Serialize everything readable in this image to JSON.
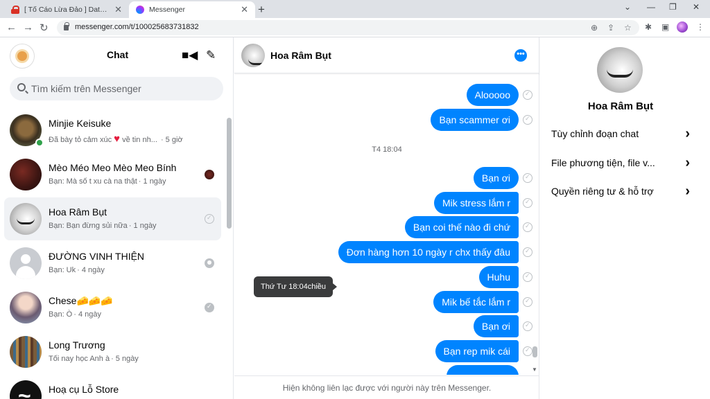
{
  "browser": {
    "tabs": [
      {
        "title": "[ Tố Cáo Lừa Đảo ] Data hệ thống",
        "close": "✕"
      },
      {
        "title": "Messenger",
        "close": "✕"
      }
    ],
    "new_tab": "+",
    "url": "messenger.com/t/100025683731832",
    "window_controls": {
      "dropdown": "⌄",
      "minimize": "—",
      "restore": "❐",
      "close": "✕"
    },
    "nav": {
      "back": "←",
      "forward": "→",
      "reload": "↻"
    },
    "omni_icons": {
      "zoom": "⊕",
      "share": "⇪",
      "bookmark": "☆"
    },
    "ext_icons": {
      "extensions": "✱",
      "sidepanel": "▣",
      "menu": "⋮"
    }
  },
  "sidebar": {
    "title": "Chat",
    "video_icon": "■◀",
    "compose_icon": "✎",
    "search_placeholder": "Tìm kiếm trên Messenger",
    "conversations": [
      {
        "name": "Minjie Keisuke",
        "preview": "Đã bày tỏ cảm xúc",
        "preview_tail": "về tin nh...",
        "time": "· 5 giờ"
      },
      {
        "name": "Mèo Méo Meo Mèo Meo Bính",
        "preview": "Bạn: Mà số t xu cà na thật",
        "time": "· 1 ngày"
      },
      {
        "name": "Hoa Râm Bụt",
        "preview": "Bạn: Bạn đừng sủi nữa",
        "time": "· 1 ngày"
      },
      {
        "name": "ĐƯỜNG VINH THIỆN",
        "preview": "Bạn: Uk",
        "time": "· 4 ngày"
      },
      {
        "name": "Chese🧀🧀🧀",
        "preview": "Bạn: Ò",
        "time": "· 4 ngày"
      },
      {
        "name": "Long Trương",
        "preview": "Tối nay học Anh à",
        "time": "· 5 ngày"
      },
      {
        "name": "Hoạ cụ Lỗ Store",
        "preview": "",
        "time": ""
      }
    ]
  },
  "chat": {
    "contact_name": "Hoa Râm Bụt",
    "info_icon": "•••",
    "messages": [
      {
        "text": "Alooooo"
      },
      {
        "text": "Bạn scammer ơi"
      },
      {
        "text": "Bạn ơi"
      },
      {
        "text": "Mik stress lắm r"
      },
      {
        "text": "Bạn coi thế nào đi chứ"
      },
      {
        "text": "Đơn hàng hơn 10 ngày r chx thấy đâu"
      },
      {
        "text": "Huhu"
      },
      {
        "text": "Mik bế tắc lắm r"
      },
      {
        "text": "Bạn ơi"
      },
      {
        "text": "Bạn rep mik cái"
      }
    ],
    "timestamp": "T4 18:04",
    "tooltip": "Thứ Tư 18:04chiều",
    "footer_notice": "Hiện không liên lạc được với người này trên Messenger.",
    "accent": "#0084ff"
  },
  "details": {
    "name": "Hoa Râm Bụt",
    "menu": [
      {
        "label": "Tùy chỉnh đoạn chat"
      },
      {
        "label": "File phương tiện, file v..."
      },
      {
        "label": "Quyền riêng tư & hỗ trợ"
      }
    ],
    "chevron": "›"
  }
}
